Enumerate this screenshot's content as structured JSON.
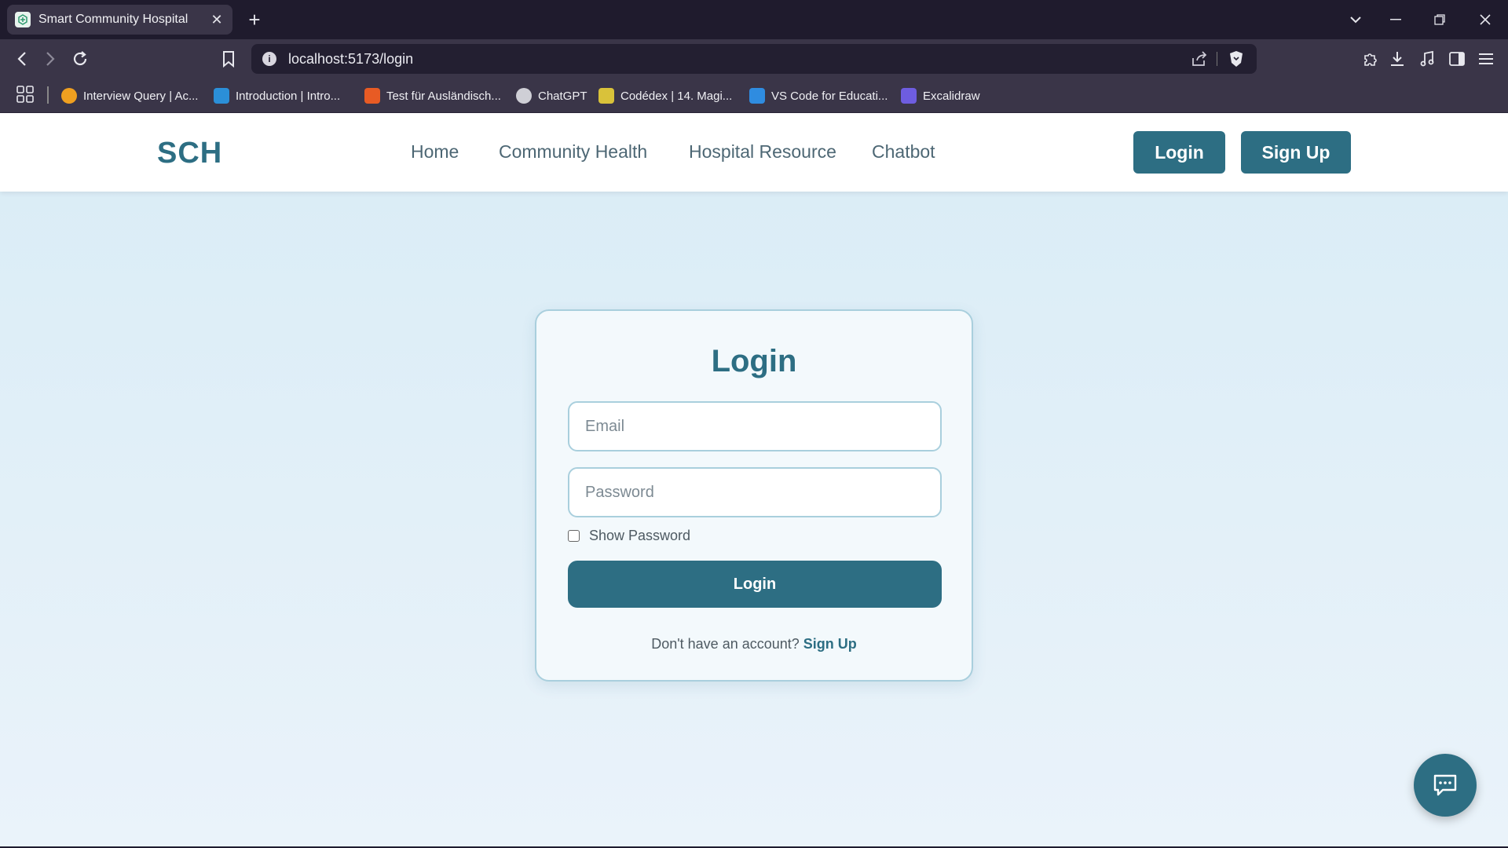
{
  "browser": {
    "tab_title": "Smart Community Hospital",
    "url": "localhost:5173/login",
    "bookmarks": [
      {
        "label": "Interview Query | Ac...",
        "icon": "interview-query-icon",
        "color": "#f0a020"
      },
      {
        "label": "Introduction | Intro...",
        "icon": "intro-icon",
        "color": "#2b8fd8"
      },
      {
        "label": "Test für Ausländisch...",
        "icon": "test-icon",
        "color": "#e85b24"
      },
      {
        "label": "ChatGPT",
        "icon": "chatgpt-icon",
        "color": "#cfcfd6"
      },
      {
        "label": "Codédex | 14. Magi...",
        "icon": "codedex-icon",
        "color": "#d9c23a"
      },
      {
        "label": "VS Code for Educati...",
        "icon": "vscode-icon",
        "color": "#2f8ce0"
      },
      {
        "label": "Excalidraw",
        "icon": "excalidraw-icon",
        "color": "#6e5de0"
      }
    ]
  },
  "nav": {
    "logo": "SCH",
    "links": [
      "Home",
      "Community Health",
      "Hospital Resource",
      "Chatbot"
    ],
    "login_label": "Login",
    "signup_label": "Sign Up"
  },
  "login_form": {
    "title": "Login",
    "email_placeholder": "Email",
    "email_value": "",
    "password_placeholder": "Password",
    "password_value": "",
    "show_password_label": "Show Password",
    "show_password_checked": false,
    "submit_label": "Login",
    "no_account_text": "Don't have an account?",
    "signup_link": "Sign Up"
  },
  "colors": {
    "brand": "#2d6e83",
    "page_bg_top": "#d9ecf6",
    "card_border": "#a9cfdd"
  }
}
